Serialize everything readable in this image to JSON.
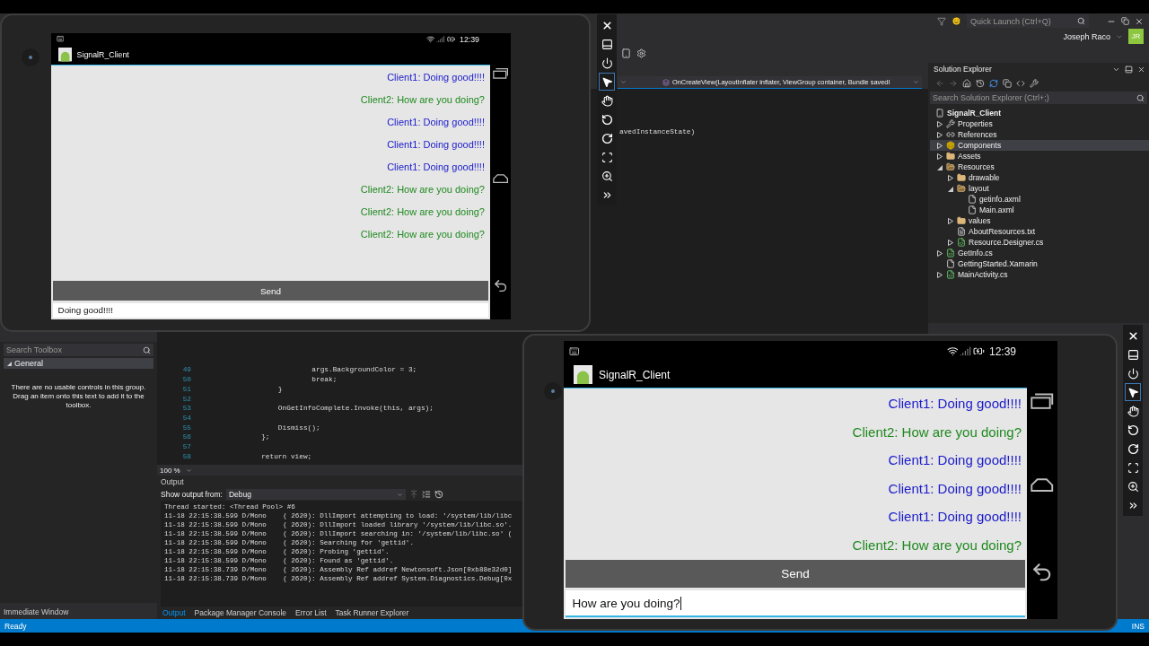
{
  "vs": {
    "quick_launch": {
      "placeholder": "Quick Launch (Ctrl+Q)"
    },
    "user": "Joseph Raco",
    "avatar": "JR",
    "nav_method": "OnCreateView(LayoutInflater inflater, ViewGroup container, Bundle savedI",
    "code_fragment": "avedInstanceState)",
    "code_lines": [
      {
        "number": "49",
        "text": "                        args.BackgroundColor = 3;"
      },
      {
        "number": "50",
        "text": "                        break;"
      },
      {
        "number": "51",
        "text": "                }"
      },
      {
        "number": "52"
      },
      {
        "number": "53",
        "text": "                OnGetInfoComplete.Invoke(this, args);"
      },
      {
        "number": "54"
      },
      {
        "number": "55",
        "text": "                Dismiss();"
      },
      {
        "number": "56",
        "text": "            };"
      },
      {
        "number": "57"
      },
      {
        "number": "58",
        "text": "            return view;"
      }
    ],
    "zoom": "100 %",
    "toolbox": {
      "search_placeholder": "Search Toolbox",
      "group": "General",
      "message": "There are no usable controls in this group. Drag an item onto this text to add it to the toolbox."
    },
    "output": {
      "title": "Output",
      "source_label": "Show output from:",
      "source": "Debug",
      "lines": [
        "Thread started: <Thread Pool> #6",
        "11-18 22:15:38.599 D/Mono    ( 2620): DllImport attempting to load: '/system/lib/libc",
        "11-18 22:15:38.599 D/Mono    ( 2620): DllImport loaded library '/system/lib/libc.so'.",
        "11-18 22:15:38.599 D/Mono    ( 2620): DllImport searching in: '/system/lib/libc.so' (",
        "11-18 22:15:38.599 D/Mono    ( 2620): Searching for 'gettid'.",
        "11-18 22:15:38.599 D/Mono    ( 2620): Probing 'gettid'.",
        "11-18 22:15:38.599 D/Mono    ( 2620): Found as 'gettid'.",
        "11-18 22:15:38.739 D/Mono    ( 2620): Assembly Ref addref Newtonsoft.Json[0xb88e32d0]",
        "11-18 22:15:38.739 D/Mono    ( 2620): Assembly Ref addref System.Diagnostics.Debug[0x"
      ]
    },
    "bottom_tabs": [
      {
        "label": "Output",
        "selected": true
      },
      {
        "label": "Package Manager Console",
        "selected": false
      },
      {
        "label": "Error List",
        "selected": false
      },
      {
        "label": "Task Runner Explorer",
        "selected": false
      }
    ],
    "immediate_window": "Immediate Window",
    "solution_explorer": {
      "title": "Solution Explorer",
      "search_placeholder": "Search Solution Explorer (Ctrl+;)",
      "tree": [
        {
          "label": "SignalR_Client",
          "kind": "project",
          "selected": false,
          "children": [
            {
              "label": "Properties",
              "kind": "wrench",
              "expanded": false,
              "selected": false
            },
            {
              "label": "References",
              "kind": "references",
              "expanded": false,
              "selected": false
            },
            {
              "label": "Components",
              "kind": "components",
              "expanded": false,
              "selected": true
            },
            {
              "label": "Assets",
              "kind": "folder",
              "expanded": false,
              "selected": false
            },
            {
              "label": "Resources",
              "kind": "folder",
              "expanded": true,
              "selected": false,
              "children": [
                {
                  "label": "drawable",
                  "kind": "folder",
                  "expanded": false,
                  "selected": false
                },
                {
                  "label": "layout",
                  "kind": "folder",
                  "expanded": true,
                  "selected": false,
                  "children": [
                    {
                      "label": "getinfo.axml",
                      "kind": "file",
                      "selected": false
                    },
                    {
                      "label": "Main.axml",
                      "kind": "file",
                      "selected": false
                    }
                  ]
                },
                {
                  "label": "values",
                  "kind": "folder",
                  "expanded": false,
                  "selected": false
                },
                {
                  "label": "AboutResources.txt",
                  "kind": "text",
                  "selected": false
                },
                {
                  "label": "Resource.Designer.cs",
                  "kind": "csharp",
                  "expanded": false,
                  "selected": false
                }
              ]
            },
            {
              "label": "GetInfo.cs",
              "kind": "csharp",
              "expanded": false,
              "selected": false
            },
            {
              "label": "GettingStarted.Xamarin",
              "kind": "file",
              "selected": false
            },
            {
              "label": "MainActivity.cs",
              "kind": "csharp",
              "expanded": false,
              "selected": false
            }
          ]
        }
      ]
    },
    "status": {
      "left": "Ready",
      "right": "INS"
    }
  },
  "emulators": [
    {
      "time": "12:39",
      "app_title": "SignalR_Client",
      "messages": [
        {
          "text": "Client1: Doing good!!!!",
          "color": "#1a1acc"
        },
        {
          "text": "Client2: How are you doing?",
          "color": "#1f8a1f"
        },
        {
          "text": "Client1: Doing good!!!!",
          "color": "#1a1acc"
        },
        {
          "text": "Client1: Doing good!!!!",
          "color": "#1a1acc"
        },
        {
          "text": "Client1: Doing good!!!!",
          "color": "#1a1acc"
        },
        {
          "text": "Client2: How are you doing?",
          "color": "#1f8a1f"
        },
        {
          "text": "Client2: How are you doing?",
          "color": "#1f8a1f"
        },
        {
          "text": "Client2: How are you doing?",
          "color": "#1f8a1f"
        }
      ],
      "send_label": "Send",
      "input_value": "Doing good!!!!",
      "focused": false,
      "toolbar": [
        {
          "kind": "close",
          "selected": false
        },
        {
          "kind": "minimize",
          "selected": false
        },
        {
          "kind": "power",
          "selected": false
        },
        {
          "kind": "pointer",
          "selected": true
        },
        {
          "kind": "touch",
          "selected": false
        },
        {
          "kind": "rotate-left",
          "selected": false
        },
        {
          "kind": "rotate-right",
          "selected": false
        },
        {
          "kind": "fit",
          "selected": false
        },
        {
          "kind": "zoom",
          "selected": false
        },
        {
          "kind": "more",
          "selected": false
        }
      ]
    },
    {
      "time": "12:39",
      "app_title": "SignalR_Client",
      "messages": [
        {
          "text": "Client1: Doing good!!!!",
          "color": "#1a1acc"
        },
        {
          "text": "Client2: How are you doing?",
          "color": "#1f8a1f"
        },
        {
          "text": "Client1: Doing good!!!!",
          "color": "#1a1acc"
        },
        {
          "text": "Client1: Doing good!!!!",
          "color": "#1a1acc"
        },
        {
          "text": "Client1: Doing good!!!!",
          "color": "#1a1acc"
        },
        {
          "text": "Client2: How are you doing?",
          "color": "#1f8a1f"
        }
      ],
      "send_label": "Send",
      "input_value": "How are you doing?",
      "focused": true,
      "toolbar": [
        {
          "kind": "close",
          "selected": false
        },
        {
          "kind": "minimize",
          "selected": false
        },
        {
          "kind": "power",
          "selected": false
        },
        {
          "kind": "pointer",
          "selected": true
        },
        {
          "kind": "touch",
          "selected": false
        },
        {
          "kind": "rotate-left",
          "selected": false
        },
        {
          "kind": "rotate-right",
          "selected": false
        },
        {
          "kind": "fit",
          "selected": false
        },
        {
          "kind": "zoom",
          "selected": false
        },
        {
          "kind": "more",
          "selected": false
        }
      ]
    }
  ]
}
